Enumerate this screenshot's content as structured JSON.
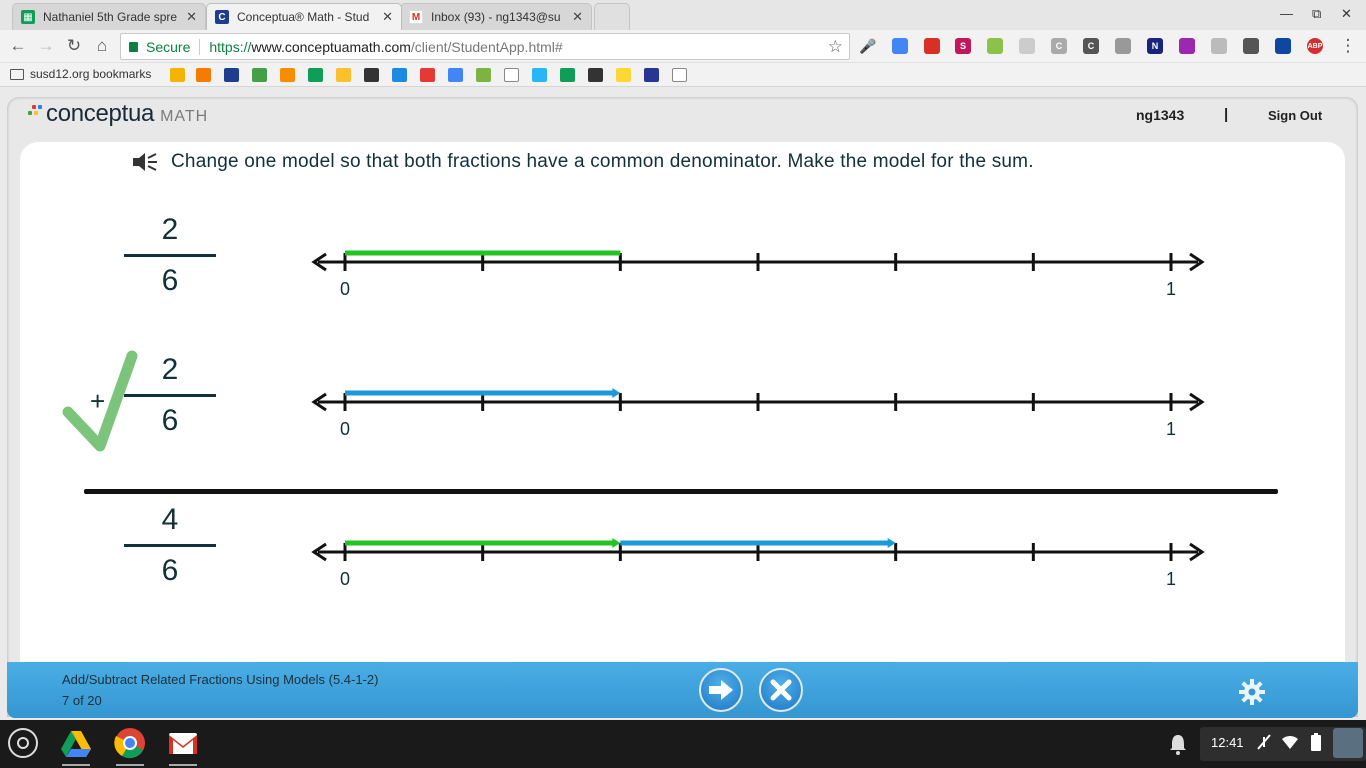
{
  "browser": {
    "tabs": [
      {
        "title": "Nathaniel 5th Grade spre",
        "icon": "sheets-icon",
        "active": false
      },
      {
        "title": "Conceptua® Math - Stud",
        "icon": "conceptua-icon",
        "active": true
      },
      {
        "title": "Inbox (93) - ng1343@su",
        "icon": "gmail-icon",
        "active": false
      }
    ],
    "secure_label": "Secure",
    "url_scheme": "https://",
    "url_host": "www.conceptuamath.com",
    "url_path": "/client/StudentApp.html#",
    "bookmarks_folder": "susd12.org bookmarks"
  },
  "app": {
    "brand": "conceptua",
    "brand_suffix": "MATH",
    "username": "ng1343",
    "divider": "|",
    "sign_out": "Sign Out",
    "prompt": "Change one model so that both fractions have a common denominator. Make the model for the sum.",
    "operator": "+",
    "rows": [
      {
        "numerator": "2",
        "denominator": "6",
        "start_label": "0",
        "end_label": "1",
        "ticks": 6,
        "segments": [
          {
            "from": 0,
            "to": 2,
            "color": "#22c322",
            "arrow": false
          }
        ]
      },
      {
        "numerator": "2",
        "denominator": "6",
        "start_label": "0",
        "end_label": "1",
        "ticks": 6,
        "segments": [
          {
            "from": 0,
            "to": 2,
            "color": "#1a9ad9",
            "arrow": true
          }
        ]
      },
      {
        "numerator": "4",
        "denominator": "6",
        "start_label": "0",
        "end_label": "1",
        "ticks": 6,
        "segments": [
          {
            "from": 0,
            "to": 2,
            "color": "#22c322",
            "arrow": true
          },
          {
            "from": 2,
            "to": 4,
            "color": "#1a9ad9",
            "arrow": true
          }
        ]
      }
    ],
    "lesson_title": "Add/Subtract Related Fractions Using Models (5.4-1-2)",
    "progress_text": "7 of 20",
    "accent_blue": "#3aa3e0",
    "check_color": "#7cc47c"
  },
  "os": {
    "clock": "12:41"
  }
}
